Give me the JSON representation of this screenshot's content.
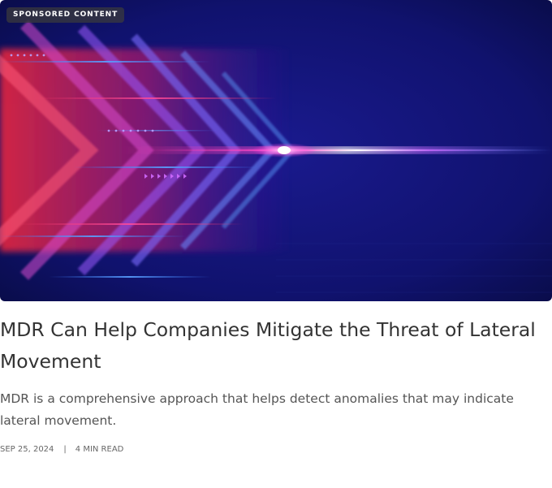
{
  "article": {
    "badge": "SPONSORED CONTENT",
    "title": "MDR Can Help Companies Mitigate the Threat of Lateral Movement",
    "summary": "MDR is a comprehensive approach that helps detect anomalies that may indicate lateral movement.",
    "date": "SEP 25, 2024",
    "separator": "|",
    "read_time": "4 MIN READ"
  },
  "colors": {
    "text": "#333333",
    "muted": "#555555",
    "hero_dark": "#0c0f5a",
    "hero_red": "#ff2a3a",
    "hero_magenta": "#ff2bd6"
  },
  "icons": {
    "hero": "abstract-chevron-light-image"
  }
}
